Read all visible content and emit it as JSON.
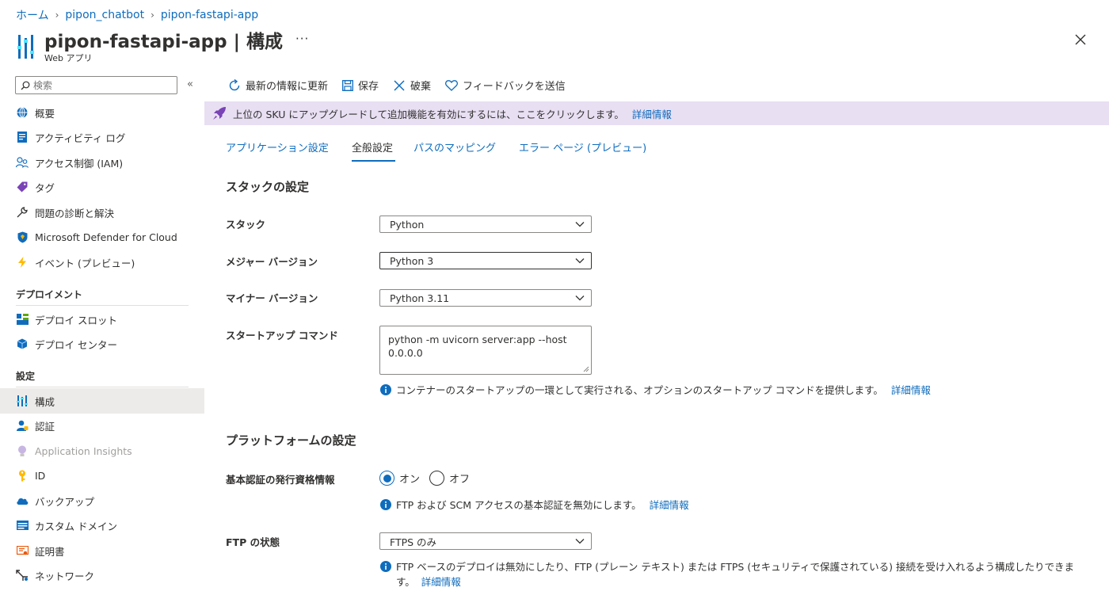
{
  "breadcrumb": {
    "home": "ホーム",
    "level1": "pipon_chatbot",
    "level2": "pipon-fastapi-app"
  },
  "header": {
    "title": "pipon-fastapi-app | 構成",
    "subtitle": "Web アプリ"
  },
  "sidebar": {
    "search_placeholder": "検索",
    "items_top": [
      {
        "label": "概要",
        "icon": "globe-icon"
      },
      {
        "label": "アクティビティ ログ",
        "icon": "log-icon"
      },
      {
        "label": "アクセス制御 (IAM)",
        "icon": "people-icon"
      },
      {
        "label": "タグ",
        "icon": "tag-icon"
      },
      {
        "label": "問題の診断と解決",
        "icon": "wrench-icon"
      },
      {
        "label": "Microsoft Defender for Cloud",
        "icon": "shield-icon"
      },
      {
        "label": "イベント (プレビュー)",
        "icon": "lightning-icon"
      }
    ],
    "section_deploy": "デプロイメント",
    "items_deploy": [
      {
        "label": "デプロイ スロット",
        "icon": "slots-icon"
      },
      {
        "label": "デプロイ センター",
        "icon": "cube-icon"
      }
    ],
    "section_settings": "設定",
    "items_settings": [
      {
        "label": "構成",
        "icon": "config-icon",
        "active": true
      },
      {
        "label": "認証",
        "icon": "auth-icon"
      },
      {
        "label": "Application Insights",
        "icon": "bulb-icon",
        "disabled": true
      },
      {
        "label": "ID",
        "icon": "key-icon"
      },
      {
        "label": "バックアップ",
        "icon": "cloud-icon"
      },
      {
        "label": "カスタム ドメイン",
        "icon": "domain-icon"
      },
      {
        "label": "証明書",
        "icon": "certificate-icon"
      },
      {
        "label": "ネットワーク",
        "icon": "network-icon"
      }
    ]
  },
  "toolbar": {
    "refresh": "最新の情報に更新",
    "save": "保存",
    "discard": "破棄",
    "feedback": "フィードバックを送信"
  },
  "banner": {
    "text": "上位の SKU にアップグレードして追加機能を有効にするには、ここをクリックします。",
    "link": "詳細情報"
  },
  "tabs": [
    "アプリケーション設定",
    "全般設定",
    "パスのマッピング",
    "エラー ページ (プレビュー)"
  ],
  "stack_section": {
    "title": "スタックの設定",
    "stack_label": "スタック",
    "stack_value": "Python",
    "major_label": "メジャー バージョン",
    "major_value": "Python 3",
    "minor_label": "マイナー バージョン",
    "minor_value": "Python 3.11",
    "startup_label": "スタートアップ コマンド",
    "startup_value": "python -m uvicorn server:app --host 0.0.0.0",
    "startup_info": "コンテナーのスタートアップの一環として実行される、オプションのスタートアップ コマンドを提供します。",
    "startup_link": "詳細情報"
  },
  "platform_section": {
    "title": "プラットフォームの設定",
    "basic_auth_label": "基本認証の発行資格情報",
    "radio_on": "オン",
    "radio_off": "オフ",
    "basic_auth_info": "FTP および SCM アクセスの基本認証を無効にします。",
    "basic_auth_link": "詳細情報",
    "ftp_label": "FTP の状態",
    "ftp_value": "FTPS のみ",
    "ftp_info": "FTP ベースのデプロイは無効にしたり、FTP (プレーン テキスト) または FTPS (セキュリティで保護されている) 接続を受け入れるよう構成したりできます。",
    "ftp_link": "詳細情報"
  },
  "colors": {
    "accent": "#0f6cbd",
    "banner_bg": "#e8dff3",
    "active_nav": "#edebe9"
  }
}
